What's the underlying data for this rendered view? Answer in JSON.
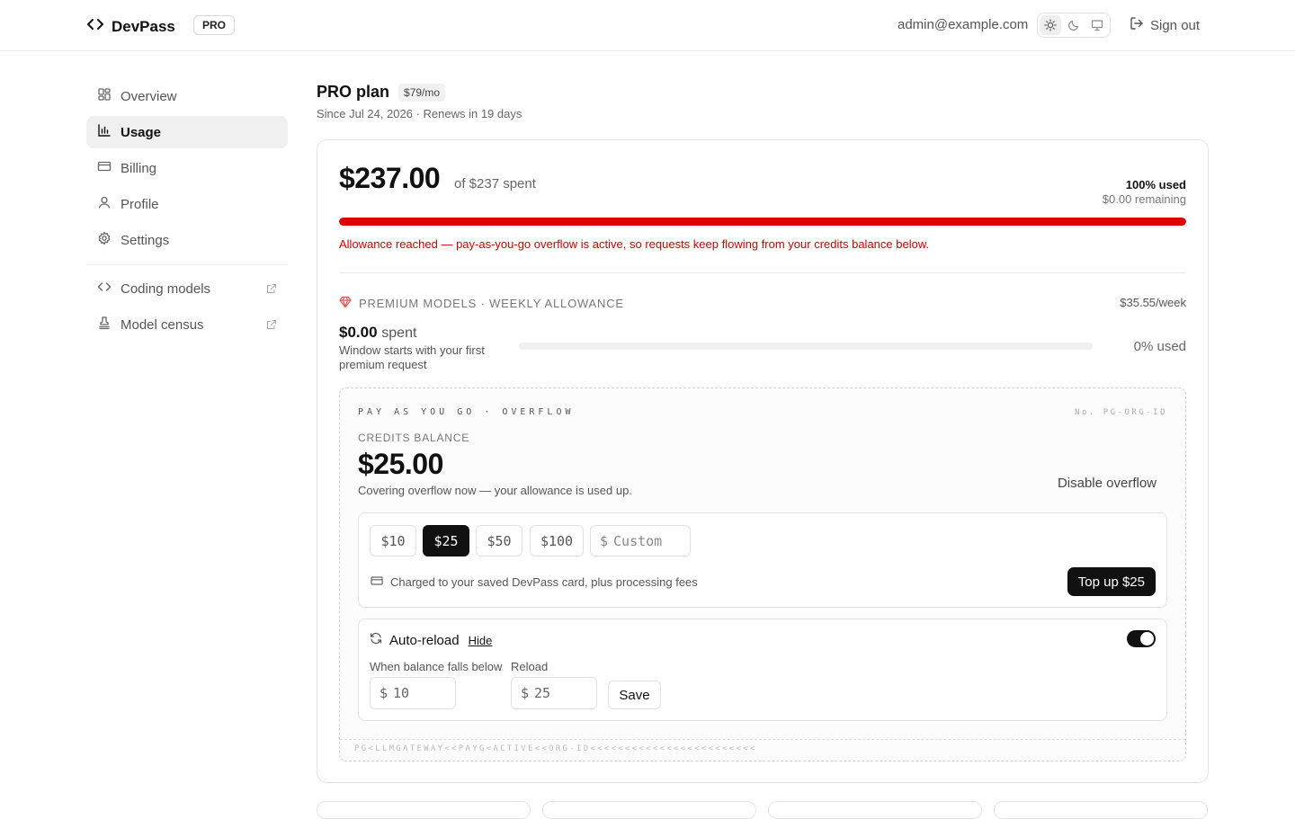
{
  "header": {
    "brand": "DevPass",
    "plan_badge": "PRO",
    "email": "admin@example.com",
    "theme_options": [
      "sun-icon",
      "moon-icon",
      "monitor-icon"
    ],
    "sign_out": "Sign out"
  },
  "sidebar": {
    "items": [
      {
        "label": "Overview",
        "icon": "grid-icon",
        "active": false
      },
      {
        "label": "Usage",
        "icon": "bar-chart-icon",
        "active": true
      },
      {
        "label": "Billing",
        "icon": "credit-card-icon",
        "active": false
      },
      {
        "label": "Profile",
        "icon": "user-icon",
        "active": false
      },
      {
        "label": "Settings",
        "icon": "gear-icon",
        "active": false
      }
    ],
    "external": [
      {
        "label": "Coding models",
        "icon": "code-icon"
      },
      {
        "label": "Model census",
        "icon": "stamp-icon"
      }
    ]
  },
  "plan": {
    "title": "PRO plan",
    "price": "$79/mo",
    "subtitle": "Since Jul 24, 2026 · Renews in 19 days"
  },
  "usage": {
    "spent": "$237.00",
    "of_text": "of $237 spent",
    "used_pct": "100% used",
    "remaining": "$0.00 remaining",
    "progress": 1.0,
    "bar_color": "#e00000",
    "warning": "Allowance reached — pay-as-you-go overflow is active, so requests keep flowing from your credits balance below."
  },
  "premium": {
    "heading": "PREMIUM MODELS · WEEKLY ALLOWANCE",
    "rate": "$35.55/week",
    "spent_value": "$0.00",
    "spent_word": "spent",
    "note": "Window starts with your first premium request",
    "used_pct": "0% used",
    "progress": 0.0
  },
  "payg": {
    "heading": "PAY AS YOU GO · OVERFLOW",
    "number": "No. PG-ORG-ID",
    "balance_label": "CREDITS BALANCE",
    "balance": "$25.00",
    "note": "Covering overflow now — your allowance is used up.",
    "disable": "Disable overflow",
    "amounts": [
      "$10",
      "$25",
      "$50",
      "$100"
    ],
    "selected_amount": "$25",
    "custom_prefix": "$",
    "custom_placeholder": "Custom",
    "charged_note": "Charged to your saved DevPass card, plus processing fees",
    "topup_label": "Top up $25",
    "auto_reload": {
      "title": "Auto-reload",
      "hide": "Hide",
      "enabled": true,
      "threshold_label": "When balance falls below",
      "threshold_prefix": "$",
      "threshold_value": "10",
      "reload_label": "Reload",
      "reload_prefix": "$",
      "reload_value": "25",
      "save": "Save"
    },
    "mrz": "PG<LLMGATEWAY<<PAYG<ACTIVE<<ORG-ID<<<<<<<<<<<<<<<<<<<<<<<<"
  }
}
